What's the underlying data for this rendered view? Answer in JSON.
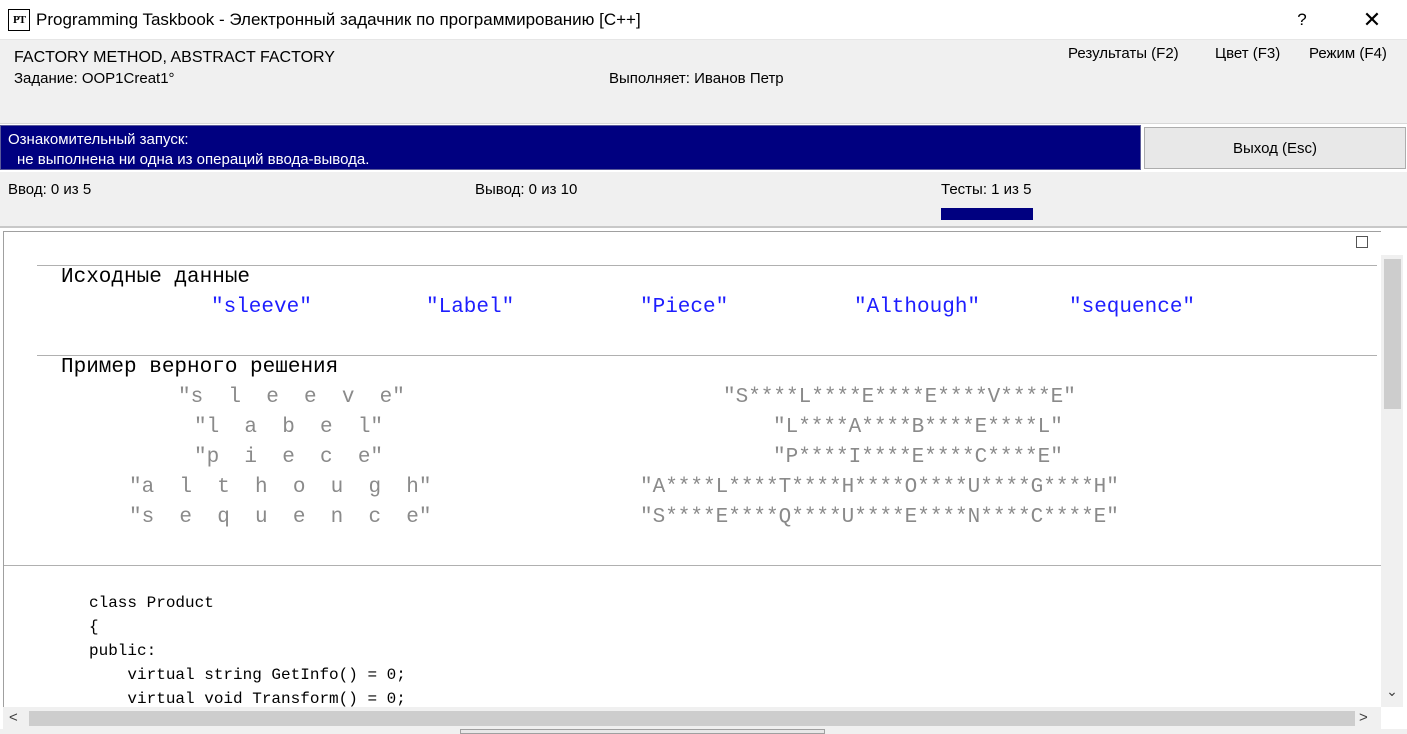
{
  "window": {
    "icon_text": "PT",
    "title": "Programming Taskbook - Электронный задачник по программированию [C++]",
    "help_label": "?",
    "close_label": "✕"
  },
  "header": {
    "group_title": "FACTORY METHOD, ABSTRACT FACTORY",
    "task_label": "Задание: OOP1Creat1°",
    "executor_label": "Выполняет: Иванов Петр",
    "menu": {
      "results": "Результаты (F2)",
      "color": "Цвет (F3)",
      "mode": "Режим (F4)"
    }
  },
  "status": {
    "line1": "Ознакомительный запуск:",
    "line2": "не выполнена ни одна из операций ввода-вывода.",
    "exit_label": "Выход (Esc)"
  },
  "counters": {
    "input": "Ввод:  0 из 5",
    "output": "Вывод:  0 из 10",
    "tests": "Тесты:  1 из 5",
    "tests_progress": 0.2
  },
  "content": {
    "input_section_title": "Исходные данные",
    "input_values": [
      "\"sleeve\"",
      "\"Label\"",
      "\"Piece\"",
      "\"Although\"",
      "\"sequence\""
    ],
    "example_section_title": "Пример верного решения",
    "example_rows": [
      {
        "left": "\"s  l  e  e  v  e\"",
        "right": "\"S****L****E****E****V****E\""
      },
      {
        "left": "\"l  a  b  e  l\"",
        "right": "\"L****A****B****E****L\""
      },
      {
        "left": "\"p  i  e  c  e\"",
        "right": "\"P****I****E****C****E\""
      },
      {
        "left": "\"a  l  t  h  o  u  g  h\"",
        "right": "\"A****L****T****H****O****U****G****H\""
      },
      {
        "left": "\"s  e  q  u  e  n  c  e\"",
        "right": "\"S****E****Q****U****E****N****C****E\""
      }
    ],
    "code_lines": [
      "class Product",
      "{",
      "public:",
      "    virtual string GetInfo() = 0;",
      "    virtual void Transform() = 0;"
    ]
  },
  "scrollbars": {
    "up_arrow": "",
    "down_arrow": "⌄",
    "left_arrow": "<",
    "right_arrow": ">"
  }
}
